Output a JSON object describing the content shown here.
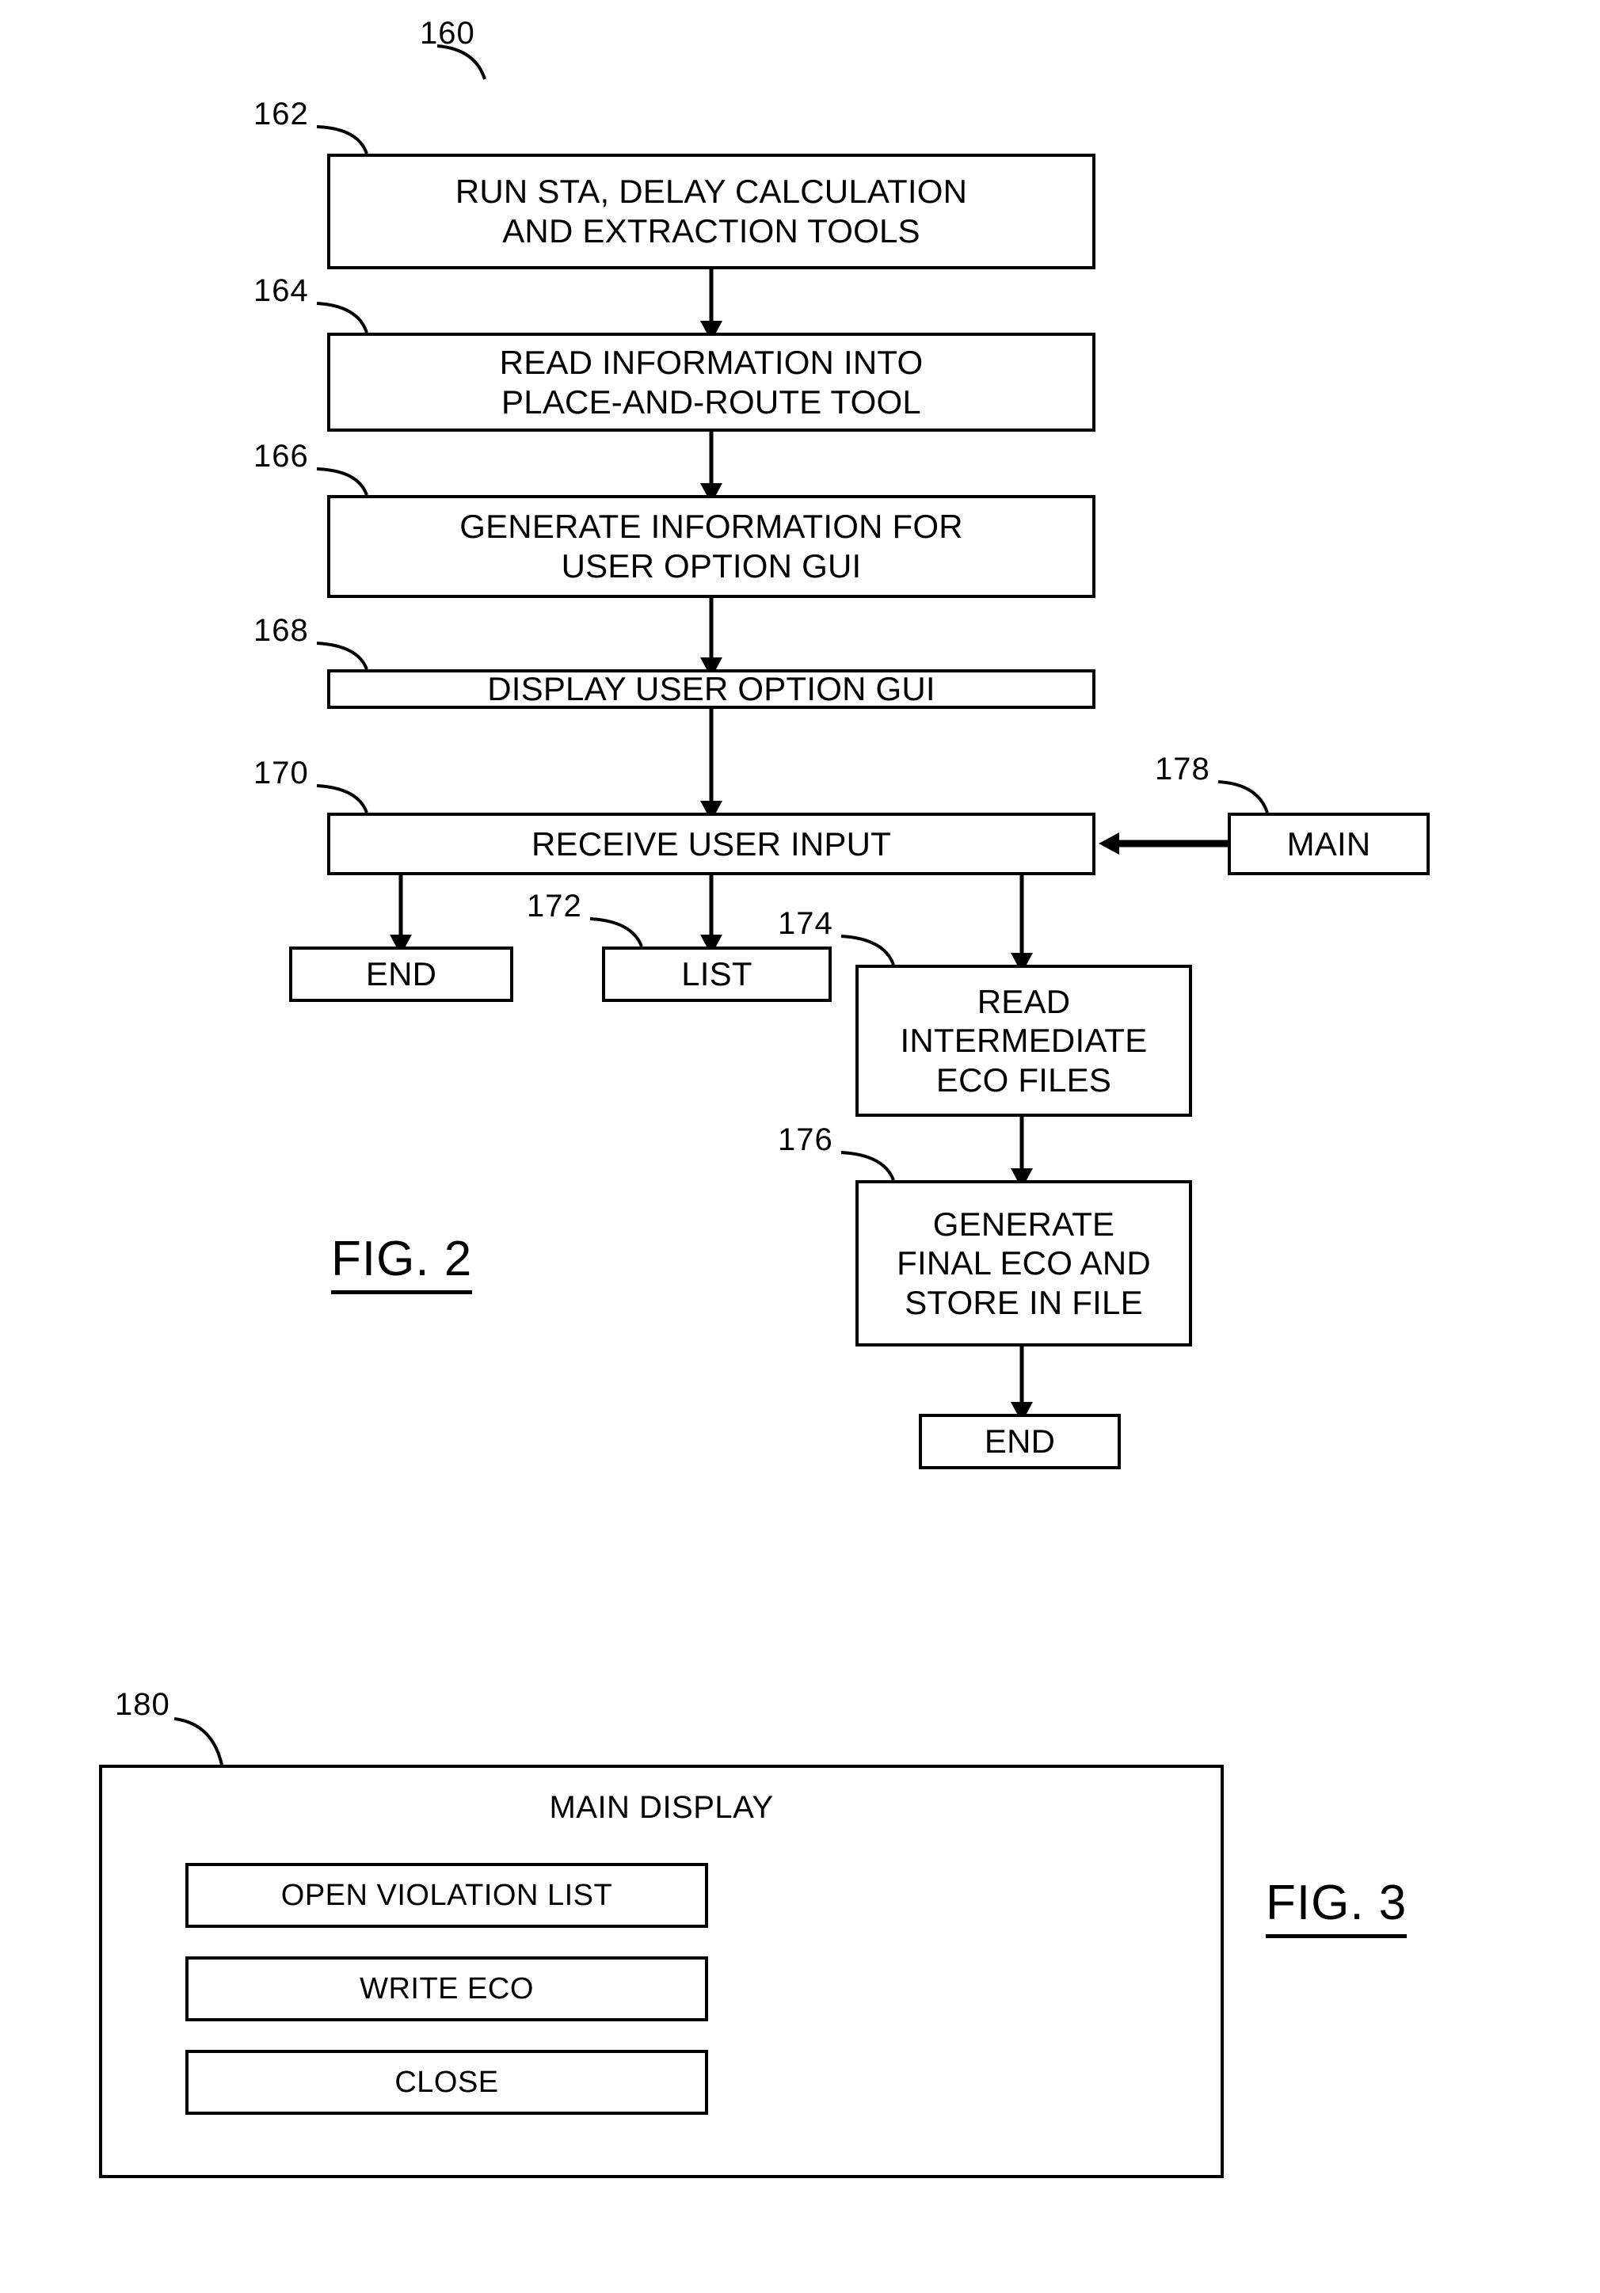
{
  "figure2": {
    "ref_overall": "160",
    "caption": "FIG. 2",
    "nodes": [
      {
        "ref": "162",
        "text": "RUN STA, DELAY CALCULATION\nAND EXTRACTION TOOLS"
      },
      {
        "ref": "164",
        "text": "READ INFORMATION INTO\nPLACE-AND-ROUTE TOOL"
      },
      {
        "ref": "166",
        "text": "GENERATE INFORMATION FOR\nUSER OPTION GUI"
      },
      {
        "ref": "168",
        "text": "DISPLAY USER OPTION GUI"
      },
      {
        "ref": "170",
        "text": "RECEIVE USER INPUT"
      },
      {
        "ref": "178",
        "text": "MAIN"
      },
      {
        "ref": "",
        "text": "END"
      },
      {
        "ref": "172",
        "text": "LIST"
      },
      {
        "ref": "174",
        "text": "READ\nINTERMEDIATE\nECO FILES"
      },
      {
        "ref": "176",
        "text": "GENERATE\nFINAL ECO AND\nSTORE IN FILE"
      },
      {
        "ref": "",
        "text": "END"
      }
    ]
  },
  "figure3": {
    "ref_panel": "180",
    "caption": "FIG. 3",
    "title": "MAIN DISPLAY",
    "buttons": [
      {
        "label": "OPEN VIOLATION LIST"
      },
      {
        "label": "WRITE ECO"
      },
      {
        "label": "CLOSE"
      }
    ]
  },
  "colors": {
    "ink": "#000000",
    "paper": "#ffffff"
  }
}
